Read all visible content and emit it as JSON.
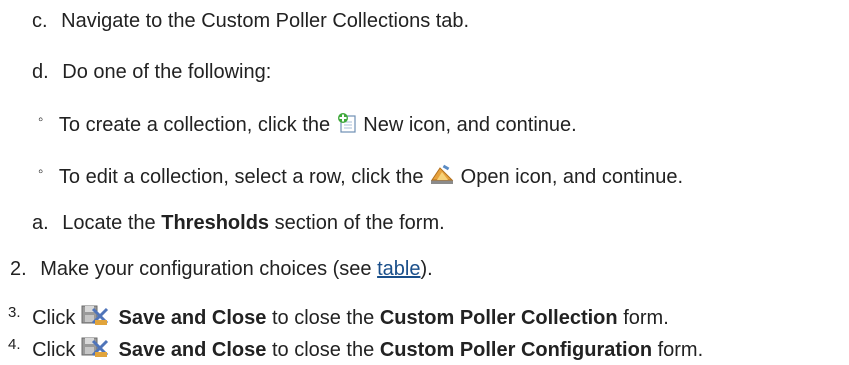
{
  "steps": {
    "c": {
      "marker": "c.",
      "text": "Navigate to the Custom Poller Collections tab."
    },
    "d": {
      "marker": "d.",
      "text": "Do one of the following:"
    },
    "sub1": {
      "marker": "◦",
      "before": "To create a collection, click the",
      "after": "New icon, and continue.",
      "icon": "new-icon"
    },
    "sub2": {
      "marker": "◦",
      "before": "To edit a collection, select a row, click the",
      "after": "Open icon, and continue.",
      "icon": "open-icon"
    },
    "a": {
      "marker": "a.",
      "before": "Locate the",
      "bold": "Thresholds",
      "after": "section of the form."
    },
    "s2": {
      "marker": "2.",
      "before": "Make your configuration choices (see",
      "link": "table",
      "after": ")."
    },
    "s3": {
      "marker": "3.",
      "click": "Click",
      "icon": "save-and-close-icon",
      "bold1": "Save and Close",
      "mid": "to close the",
      "bold2": "Custom Poller Collection",
      "end": "form."
    },
    "s4": {
      "marker": "4.",
      "click": "Click",
      "icon": "save-and-close-icon",
      "bold1": "Save and Close",
      "mid": "to close the",
      "bold2": "Custom Poller Configuration",
      "end": "form."
    }
  }
}
